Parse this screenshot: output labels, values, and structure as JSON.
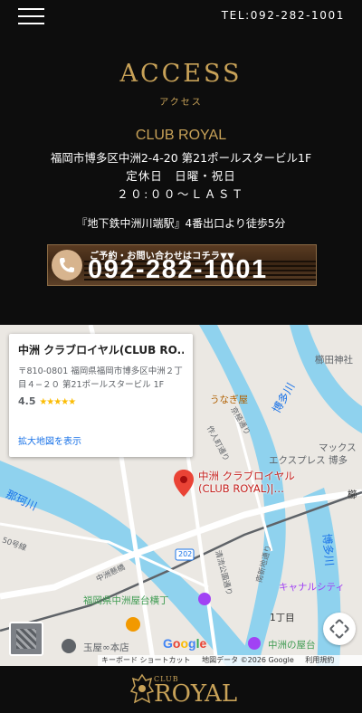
{
  "header": {
    "tel": "TEL:092-282-1001"
  },
  "access": {
    "title": "ACCESS",
    "subtitle": "アクセス",
    "club_name": "CLUB ROYAL",
    "address": "福岡市博多区中洲2-4-20 第21ポールスタービル1F",
    "closed": "定休日　日曜・祝日",
    "hours": "２０:００～ＬＡＳＴ",
    "station": "『地下鉄中洲川端駅』4番出口より徒歩5分"
  },
  "tel_banner": {
    "small_text": "ご予約・お問い合わせはコチラ▼▼",
    "number": "092-282-1001"
  },
  "map": {
    "card": {
      "name": "中洲 クラブロイヤル(CLUB RO...",
      "address": "〒810-0801 福岡県福岡市博多区中洲２丁目４−２０ 第21ポールスタービル 1F",
      "rating": "4.5",
      "stars": "★★★★★",
      "link": "拡大地図を表示"
    },
    "pin_label_1": "中洲 クラブロイヤル",
    "pin_label_2": "(CLUB ROYAL)|…",
    "labels": {
      "kushida": "櫛田神社",
      "unagi": "うなぎ屋",
      "hakatagawa": "博多川",
      "kyoya": "京極通り",
      "sakuninn": "作人町通り",
      "max": "マックス",
      "express": "エクスプレス 博多",
      "nakagawa": "那珂川",
      "cinemas": "50号線",
      "nakasu_bridge": "中洲懸橋",
      "kiyotaki": "清流公園通り",
      "nanshin": "南新地通り",
      "hakatagawa2": "博多川",
      "canal": "キャナルシティ",
      "yatai": "福岡県中洲屋台横丁",
      "chome": "1丁目",
      "tamaya": "玉屋∞本店",
      "nakasu_yatai": "中洲の屋台",
      "route": "202",
      "kushi": "櫛"
    },
    "google": "Google",
    "footer": {
      "shortcuts": "キーボード ショートカット",
      "mapdata": "地図データ ©2026 Google",
      "terms": "利用規約"
    }
  },
  "footer": {
    "logo_small": "CLUB",
    "logo_text": "ROYAL"
  }
}
